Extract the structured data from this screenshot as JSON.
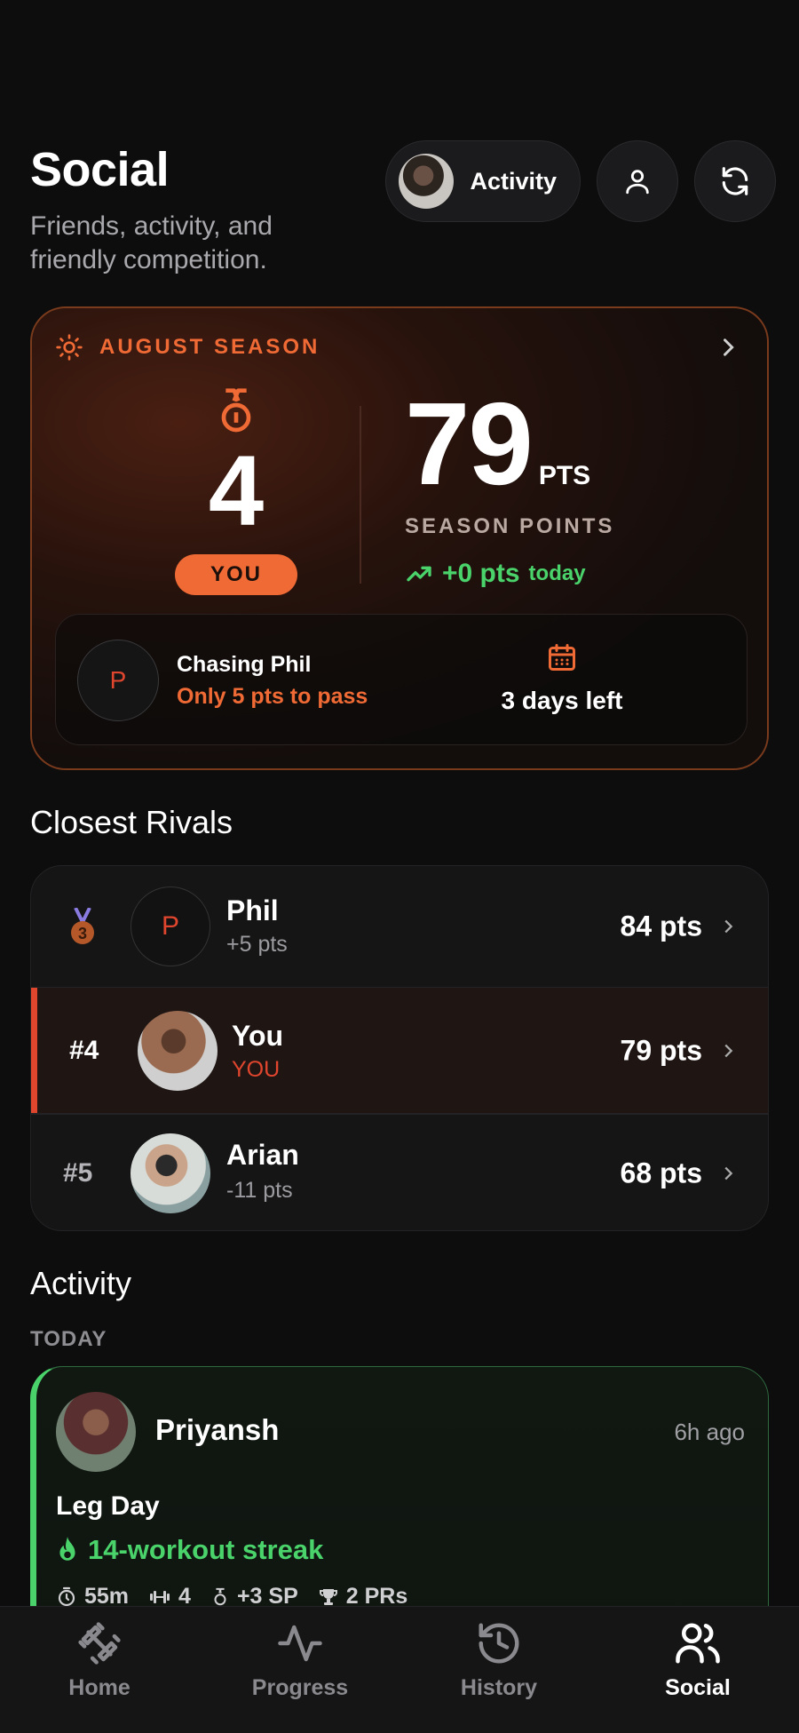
{
  "header": {
    "title": "Social",
    "subtitle": "Friends, activity, and friendly competition.",
    "activity_label": "Activity"
  },
  "season": {
    "title": "AUGUST SEASON",
    "rank": "4",
    "you_badge": "YOU",
    "points": "79",
    "points_unit": "PTS",
    "points_label": "SEASON POINTS",
    "delta": "+0 pts",
    "delta_suffix": "today",
    "chasing_initial": "P",
    "chasing_title": "Chasing Phil",
    "chasing_sub": "Only 5 pts to pass",
    "days_left": "3 days left"
  },
  "rivals": {
    "title": "Closest Rivals",
    "items": [
      {
        "rank": "",
        "initial": "P",
        "name": "Phil",
        "sub": "+5 pts",
        "pts": "84 pts"
      },
      {
        "rank": "#4",
        "initial": "",
        "name": "You",
        "sub": "YOU",
        "pts": "79 pts"
      },
      {
        "rank": "#5",
        "initial": "",
        "name": "Arian",
        "sub": "-11 pts",
        "pts": "68 pts"
      }
    ]
  },
  "activity": {
    "title": "Activity",
    "today_label": "TODAY",
    "card": {
      "name": "Priyansh",
      "time": "6h ago",
      "workout": "Leg Day",
      "streak": "14-workout streak",
      "duration": "55m",
      "exercises": "4",
      "sp": "+3 SP",
      "prs": "2 PRs"
    }
  },
  "tabs": [
    {
      "label": "Home"
    },
    {
      "label": "Progress"
    },
    {
      "label": "History"
    },
    {
      "label": "Social"
    }
  ],
  "colors": {
    "accent": "#f06a35",
    "rival_red": "#e0452e",
    "green": "#4bd36b"
  }
}
